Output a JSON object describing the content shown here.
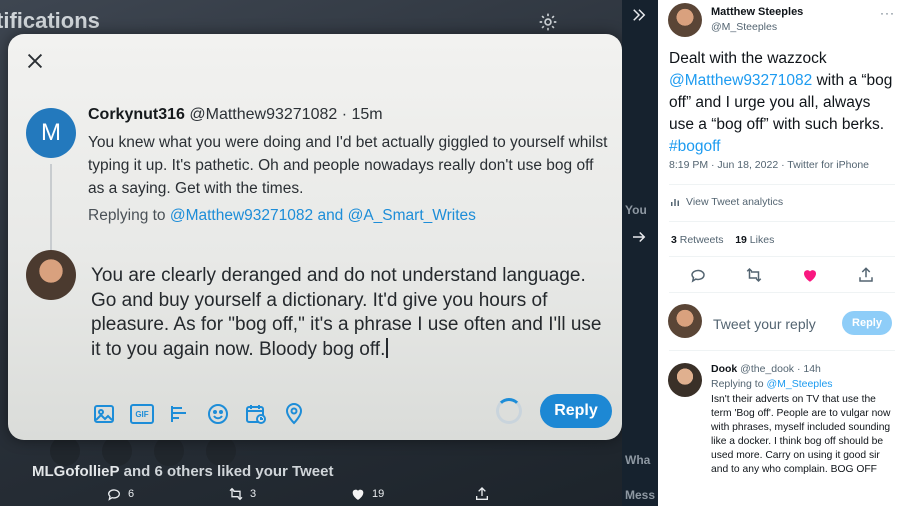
{
  "photo": {
    "bg_title": "tifications",
    "bg_liked_name": "MLGofollieP",
    "bg_liked_rest": " and 6 others liked your Tweet",
    "bg_actions": {
      "reply_count": "6",
      "retweet_count": "3",
      "like_count": "19"
    }
  },
  "compose": {
    "replied_tweet": {
      "avatar_letter": "M",
      "author": "Corkynut316",
      "handle_time": " @Matthew93271082 · 15m",
      "text": "You knew what you were doing and I'd bet actually giggled to yourself whilst typing it up. It's pathetic. Oh and people nowadays really don't use bog off as a saying. Get with the times.",
      "replying_prefix": "Replying to ",
      "replying_to": "@Matthew93271082 and @A_Smart_Writes"
    },
    "draft": "You are clearly deranged and do not understand language. Go and buy yourself a dictionary. It'd give you hours of pleasure. As for \"bog off,\" it's a phrase I use often and I'll use it to you again now. Bloody bog off.",
    "reply_label": "Reply",
    "gif_label": "GIF",
    "icons": [
      "image-icon",
      "gif-icon",
      "poll-icon",
      "emoji-icon",
      "schedule-icon",
      "location-icon"
    ]
  },
  "strip": {
    "text_you": "You",
    "text_wha": "Wha",
    "text_mess": "Mess"
  },
  "tweet": {
    "author": "Matthew Steeples",
    "handle": "@M_Steeples",
    "more": "···",
    "text_1": "Dealt with the wazzock ",
    "mention": "@Matthew93271082",
    "text_2": " with a “bog off” and I urge you all, always use a “bog off” with such berks. ",
    "hashtag": "#bogoff",
    "meta": "8:19 PM · Jun 18, 2022 · Twitter for iPhone",
    "analytics_label": "View Tweet analytics",
    "retweets_count": "3",
    "retweets_label": " Retweets",
    "likes_count": "19",
    "likes_label": " Likes",
    "colors": {
      "like_active": "#f91880",
      "link": "#1d9bf0"
    }
  },
  "reply_box": {
    "placeholder": "Tweet your reply",
    "button": "Reply"
  },
  "comment": {
    "author": "Dook",
    "handle_time": " @the_dook · 14h",
    "replying_prefix": "Replying to ",
    "replying_to": "@M_Steeples",
    "text": "Isn't their adverts on TV that use the term 'Bog off'. People are to vulgar now with phrases, myself included sounding like a docker. I think bog off should be used more. Carry on using it good sir and to any who complain. BOG OFF"
  }
}
